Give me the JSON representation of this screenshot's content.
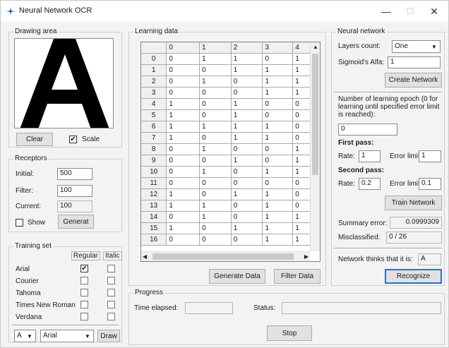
{
  "window": {
    "title": "Neural Network OCR",
    "minimize": "—",
    "maximize": "☐",
    "close": "✕"
  },
  "drawing": {
    "group": "Drawing area",
    "glyph": "A",
    "clear": "Clear",
    "scale_label": "Scale",
    "scale_checked": true
  },
  "receptors": {
    "group": "Receptors",
    "initial_label": "Initial:",
    "initial": "500",
    "filter_label": "Filter:",
    "filter": "100",
    "current_label": "Current:",
    "current": "100",
    "show_label": "Show",
    "generate": "Generat"
  },
  "training": {
    "group": "Training set",
    "regular": "Regular",
    "italic": "Italic",
    "fonts": [
      {
        "name": "Arial",
        "regular": true,
        "italic": false
      },
      {
        "name": "Courier",
        "regular": false,
        "italic": false
      },
      {
        "name": "Tahoma",
        "regular": false,
        "italic": false
      },
      {
        "name": "Times New Roman",
        "regular": false,
        "italic": false
      },
      {
        "name": "Verdana",
        "regular": false,
        "italic": false
      }
    ],
    "letter": "A",
    "font": "Arial",
    "draw": "Draw"
  },
  "learning": {
    "group": "Learning data",
    "columns": [
      "0",
      "1",
      "2",
      "3",
      "4"
    ],
    "rows": [
      [
        "0",
        "0",
        "1",
        "1",
        "0",
        "1"
      ],
      [
        "1",
        "0",
        "0",
        "1",
        "1",
        "1"
      ],
      [
        "2",
        "0",
        "1",
        "0",
        "1",
        "1"
      ],
      [
        "3",
        "0",
        "0",
        "0",
        "1",
        "1"
      ],
      [
        "4",
        "1",
        "0",
        "1",
        "0",
        "0"
      ],
      [
        "5",
        "1",
        "0",
        "1",
        "0",
        "0"
      ],
      [
        "6",
        "1",
        "1",
        "1",
        "1",
        "0"
      ],
      [
        "7",
        "1",
        "0",
        "1",
        "1",
        "0"
      ],
      [
        "8",
        "0",
        "1",
        "0",
        "0",
        "1"
      ],
      [
        "9",
        "0",
        "0",
        "1",
        "0",
        "1"
      ],
      [
        "10",
        "0",
        "1",
        "0",
        "1",
        "1"
      ],
      [
        "11",
        "0",
        "0",
        "0",
        "0",
        "0"
      ],
      [
        "12",
        "1",
        "0",
        "1",
        "1",
        "0"
      ],
      [
        "13",
        "1",
        "1",
        "0",
        "1",
        "0"
      ],
      [
        "14",
        "0",
        "1",
        "0",
        "1",
        "1"
      ],
      [
        "15",
        "1",
        "0",
        "1",
        "1",
        "1"
      ],
      [
        "16",
        "0",
        "0",
        "0",
        "1",
        "1"
      ]
    ],
    "generate": "Generate Data",
    "filter": "Filter Data"
  },
  "network": {
    "group": "Neural network",
    "layers_label": "Layers count:",
    "layers": "One",
    "alfa_label": "Sigmoid's Alfa:",
    "alfa": "1",
    "create": "Create Network",
    "epoch_desc": "Number of learning epoch (0 for learning until specified error limit is reached):",
    "epoch": "0",
    "first_pass": "First pass:",
    "rate_label": "Rate:",
    "rate1": "1",
    "error_label": "Error limit",
    "error1": "1",
    "second_pass": "Second pass:",
    "rate2": "0.2",
    "error2": "0.1",
    "train": "Train Network",
    "summary_label": "Summary error:",
    "summary": "0.0999309",
    "miscl_label": "Misclassified:",
    "miscl": "0 / 26",
    "thinks_label": "Network thinks that it is:",
    "thinks": "A",
    "recognize": "Recognize"
  },
  "progress": {
    "group": "Progress",
    "elapsed_label": "Time elapsed:",
    "elapsed": "",
    "status_label": "Status:",
    "status": "",
    "stop": "Stop"
  }
}
